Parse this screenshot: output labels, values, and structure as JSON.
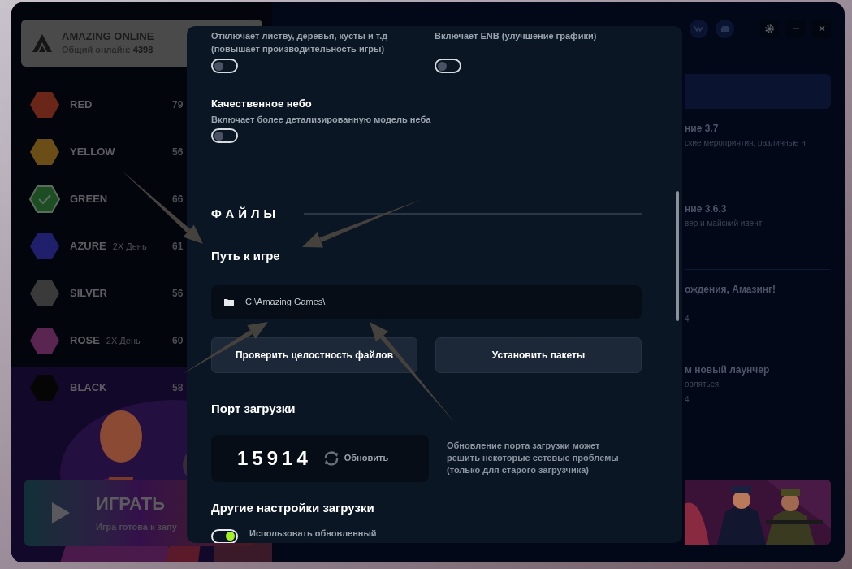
{
  "server_card": {
    "title": "AMAZING ONLINE",
    "online_label": "Общий онлайн:",
    "online_count": "4398"
  },
  "servers": [
    {
      "name": "RED",
      "count": "79",
      "color": "#6a2618",
      "selected": false
    },
    {
      "name": "YELLOW",
      "count": "56",
      "color": "#6b4d17",
      "selected": false
    },
    {
      "name": "GREEN",
      "count": "66",
      "color": "#1d4d22",
      "selected": true
    },
    {
      "name": "AZURE",
      "badge": "2X День",
      "count": "61",
      "color": "#1f1f6b",
      "selected": false
    },
    {
      "name": "SILVER",
      "count": "56",
      "color": "#3a3a3a",
      "selected": false
    },
    {
      "name": "ROSE",
      "badge": "2X День",
      "count": "60",
      "color": "#5a2550",
      "selected": false
    },
    {
      "name": "BLACK",
      "count": "58",
      "color": "#050505",
      "selected": false
    }
  ],
  "play": {
    "title": "ИГРАТЬ",
    "subtitle": "Игра готова к запу"
  },
  "news": [
    {
      "title": "ние 3.7",
      "text": "ские мероприятия, различные н"
    },
    {
      "title": "ние 3.6.3",
      "text": "вер и майский ивент"
    },
    {
      "title": "ождения, Амазинг!",
      "date": "4"
    },
    {
      "title": "м новый лаунчер",
      "text": "овляться!",
      "date": "4"
    }
  ],
  "settings": {
    "top_toggles": [
      {
        "description": "Отключает листву, деревья, кусты и т.д (повышает производительность игры)",
        "on": false
      },
      {
        "description": "Включает ENB (улучшение графики)",
        "on": false
      }
    ],
    "sky": {
      "title": "Качественное небо",
      "description": "Включает более детализированную модель неба",
      "on": false
    },
    "files": {
      "heading": "ФАЙЛЫ",
      "path_label": "Путь к игре",
      "path_value": "C:\\Amazing Games\\",
      "buttons": [
        "Проверить целостность файлов",
        "Установить пакеты"
      ]
    },
    "port": {
      "heading": "Порт загрузки",
      "value": "15914",
      "refresh": "Обновить",
      "note": "Обновление порта загрузки может решить некоторые сетевые проблемы (только для старого загрузчика)"
    },
    "other": {
      "heading": "Другие настройки загрузки",
      "toggles": [
        {
          "label": "Использовать обновленный",
          "on": true
        }
      ]
    }
  }
}
